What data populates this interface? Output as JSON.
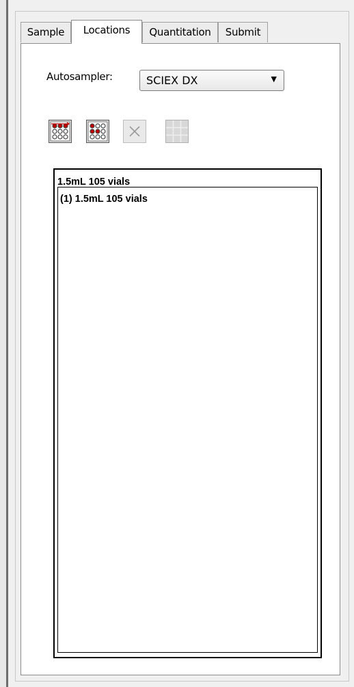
{
  "tabs": [
    {
      "label": "Sample",
      "active": false
    },
    {
      "label": "Locations",
      "active": true
    },
    {
      "label": "Quantitation",
      "active": false
    },
    {
      "label": "Submit",
      "active": false
    }
  ],
  "autosampler": {
    "label": "Autosampler:",
    "selected": "SCIEX DX"
  },
  "toolbar": {
    "icons": [
      "rack-fill-row-icon",
      "rack-fill-column-icon",
      "delete-icon",
      "grid-icon"
    ],
    "accent": "#c00000"
  },
  "rack_list": {
    "header": "1.5mL 105 vials",
    "items": [
      "(1) 1.5mL 105 vials"
    ]
  }
}
